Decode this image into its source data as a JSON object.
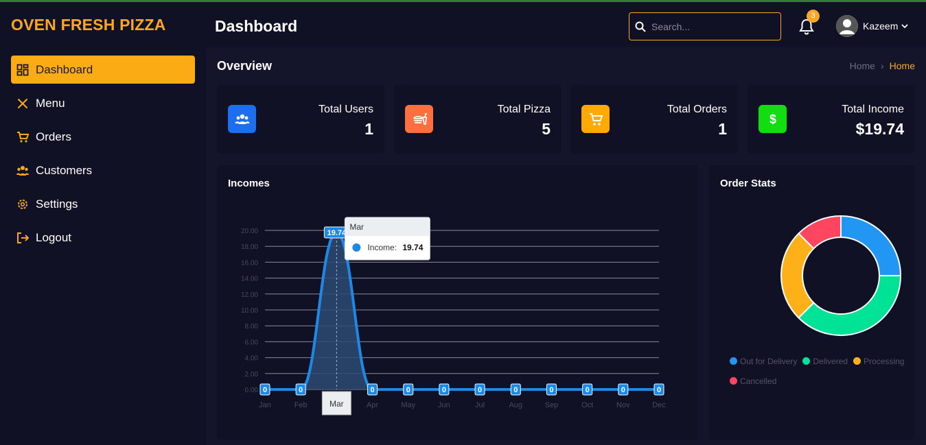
{
  "app": {
    "brand": "OVEN FRESH PIZZA"
  },
  "sidebar": {
    "items": [
      {
        "label": "Dashboard",
        "icon": "dashboard-icon",
        "active": true
      },
      {
        "label": "Menu",
        "icon": "utensils-icon"
      },
      {
        "label": "Orders",
        "icon": "cart-icon"
      },
      {
        "label": "Customers",
        "icon": "users-icon"
      },
      {
        "label": "Settings",
        "icon": "gear-icon"
      },
      {
        "label": "Logout",
        "icon": "logout-icon"
      }
    ]
  },
  "header": {
    "title": "Dashboard",
    "search_placeholder": "Search...",
    "notifications": "3",
    "user_name": "Kazeem"
  },
  "overview": {
    "title": "Overview",
    "breadcrumb": [
      "Home",
      "Home"
    ]
  },
  "stats": [
    {
      "label": "Total Users",
      "value": "1",
      "color": "#1e6ff0",
      "icon": "users-icon"
    },
    {
      "label": "Total Pizza",
      "value": "5",
      "color": "#ff6f3f",
      "icon": "fastfood-icon"
    },
    {
      "label": "Total Orders",
      "value": "1",
      "color": "#ffaa00",
      "icon": "cart-icon"
    },
    {
      "label": "Total Income",
      "value": "$19.74",
      "color": "#11dd11",
      "icon": "dollar-icon"
    }
  ],
  "incomes": {
    "title": "Incomes",
    "tooltip": {
      "title": "Mar",
      "series": "Income:",
      "value": "19.74"
    },
    "xtooltip": "Mar"
  },
  "order_stats": {
    "title": "Order Stats"
  },
  "chart_data": [
    {
      "type": "area",
      "title": "Incomes",
      "categories": [
        "Jan",
        "Feb",
        "Mar",
        "Apr",
        "May",
        "Jun",
        "Jul",
        "Aug",
        "Sep",
        "Oct",
        "Nov",
        "Dec"
      ],
      "series": [
        {
          "name": "Income",
          "values": [
            0,
            0,
            19.74,
            0,
            0,
            0,
            0,
            0,
            0,
            0,
            0,
            0
          ]
        }
      ],
      "data_labels": [
        "0",
        "0",
        "19.74",
        "0",
        "0",
        "0",
        "0",
        "0",
        "0",
        "0",
        "0",
        "0"
      ],
      "yticks": [
        "0.00",
        "2.00",
        "4.00",
        "6.00",
        "8.00",
        "10.00",
        "12.00",
        "14.00",
        "16.00",
        "18.00",
        "20.00"
      ],
      "ylim": [
        0,
        20
      ],
      "grid": true,
      "color": "#1e88e5"
    },
    {
      "type": "pie",
      "title": "Order Stats",
      "labels": [
        "Out for Delivery",
        "Delivered",
        "Processing",
        "Cancelled"
      ],
      "values": [
        25,
        37.5,
        25,
        12.5
      ],
      "colors": [
        "#2196f3",
        "#00e396",
        "#feb019",
        "#ff4560"
      ],
      "legend": "bottom"
    }
  ]
}
